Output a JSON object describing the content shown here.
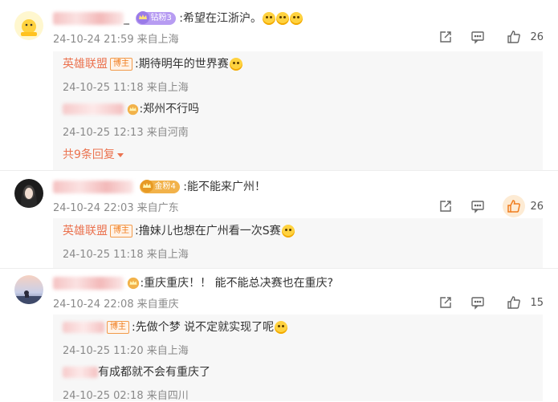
{
  "comments": [
    {
      "username_visible": "_",
      "badge": "钻粉3",
      "text": ":希望在江浙沪。",
      "date": "24-10-24 21:59",
      "location": "来自上海",
      "likes": "26",
      "liked": false,
      "replies": [
        {
          "author": "英雄联盟",
          "is_op": true,
          "op_label": "博主",
          "text": ":期待明年的世界赛",
          "date": "24-10-25 11:18",
          "location": "来自上海"
        },
        {
          "author": "",
          "is_op": false,
          "text": ":郑州不行吗",
          "date": "24-10-25 12:13",
          "location": "来自河南"
        }
      ],
      "more_replies": "共9条回复"
    },
    {
      "badge": "金粉4",
      "text": ":能不能来广州！",
      "date": "24-10-24 22:03",
      "location": "来自广东",
      "likes": "26",
      "liked": true,
      "replies": [
        {
          "author": "英雄联盟",
          "is_op": true,
          "op_label": "博主",
          "text": ":撸妹儿也想在广州看一次S赛",
          "date": "24-10-25 11:18",
          "location": "来自上海"
        }
      ]
    },
    {
      "text": ":重庆重庆！！ 能不能总决赛也在重庆?",
      "date": "24-10-24 22:08",
      "location": "来自重庆",
      "likes": "15",
      "liked": false,
      "replies": [
        {
          "author": "",
          "is_op": true,
          "op_label": "博主",
          "text": ":先做个梦 说不定就实现了呢",
          "date": "24-10-25 11:20",
          "location": "来自上海"
        },
        {
          "author": "",
          "is_op": false,
          "text": "有成都就不会有重庆了",
          "date": "24-10-25 02:18",
          "location": "来自四川"
        }
      ]
    }
  ],
  "icons": {
    "share": "share-icon",
    "comment": "comment-icon",
    "like": "thumbs-up-icon",
    "crown": "crown-badge-icon",
    "emoji": "emoji-icon"
  },
  "colors": {
    "accent": "#eb7350",
    "meta_gray": "#8a8a8a",
    "reply_bg": "#f7f7f7",
    "liked_bg": "#fdebd4",
    "diamond_badge": "#b79cf2",
    "gold_badge": "#f2b24a"
  }
}
